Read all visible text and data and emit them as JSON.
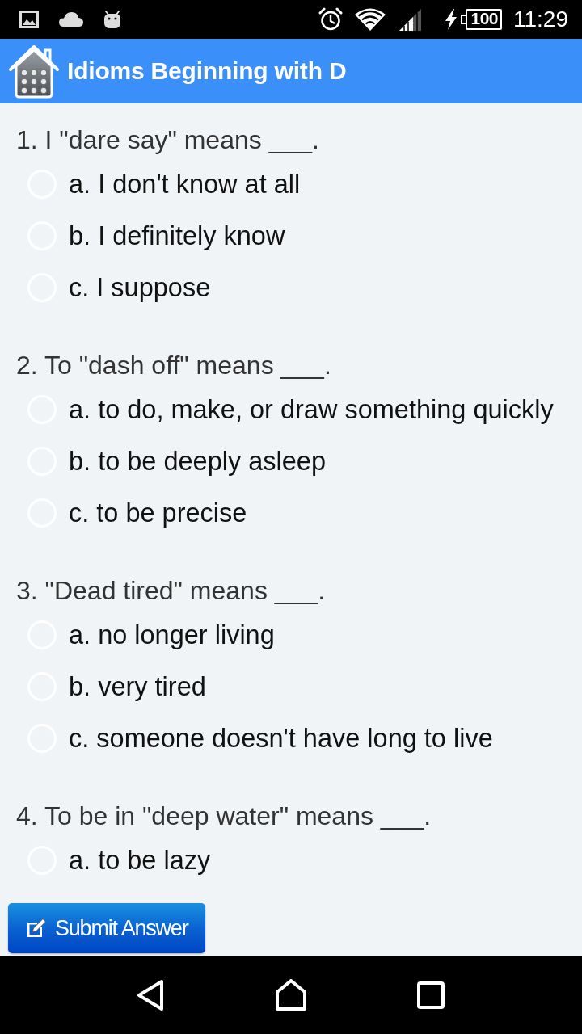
{
  "status_bar": {
    "battery": "100",
    "time": "11:29"
  },
  "app_bar": {
    "title": "Idioms Beginning with D"
  },
  "questions": [
    {
      "text": "1. I \"dare say\" means ___.",
      "options": [
        {
          "label": "a. I don't know at all",
          "selected": false
        },
        {
          "label": "b. I definitely know",
          "selected": false
        },
        {
          "label": "c. I suppose",
          "selected": false
        }
      ]
    },
    {
      "text": "2. To \"dash off\" means ___.",
      "options": [
        {
          "label": "a. to do, make, or draw something quickly",
          "selected": false
        },
        {
          "label": "b. to be deeply asleep",
          "selected": false
        },
        {
          "label": "c. to be precise",
          "selected": false
        }
      ]
    },
    {
      "text": "3. \"Dead tired\" means ___.",
      "options": [
        {
          "label": "a. no longer living",
          "selected": false
        },
        {
          "label": "b. very tired",
          "selected": false
        },
        {
          "label": "c. someone doesn't have long to live",
          "selected": false
        }
      ]
    },
    {
      "text": "4. To be in \"deep water\" means ___.",
      "options": [
        {
          "label": "a. to be lazy",
          "selected": false
        }
      ]
    }
  ],
  "submit_button": {
    "label": "Submit Answer"
  }
}
